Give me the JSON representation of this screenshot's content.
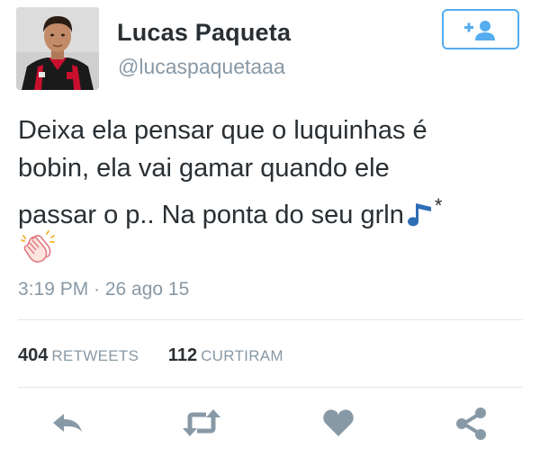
{
  "user": {
    "display_name": "Lucas Paqueta",
    "handle": "@lucaspaquetaaa"
  },
  "follow_button": {
    "icon": "follow-user-icon",
    "color": "#55acee"
  },
  "tweet": {
    "lines": [
      "Deixa ela pensar que o luquinhas é",
      "bobin, ela vai gamar quando ele",
      "passar o p.. Na ponta do seu grln"
    ],
    "trailing_mark": "*",
    "emojis": [
      "musical-note-emoji",
      "clapping-hands-emoji"
    ],
    "timestamp": "3:19 PM · 26 ago 15"
  },
  "stats": {
    "retweets_count": "404",
    "retweets_label": "RETWEETS",
    "likes_count": "112",
    "likes_label": "CURTIRAM"
  },
  "actions": [
    "reply-icon",
    "retweet-icon",
    "like-icon",
    "share-icon"
  ],
  "colors": {
    "text": "#292f33",
    "muted": "#8899a6",
    "divider": "#e1e8ed",
    "accent": "#55acee",
    "action_icons": "#8899a6"
  }
}
